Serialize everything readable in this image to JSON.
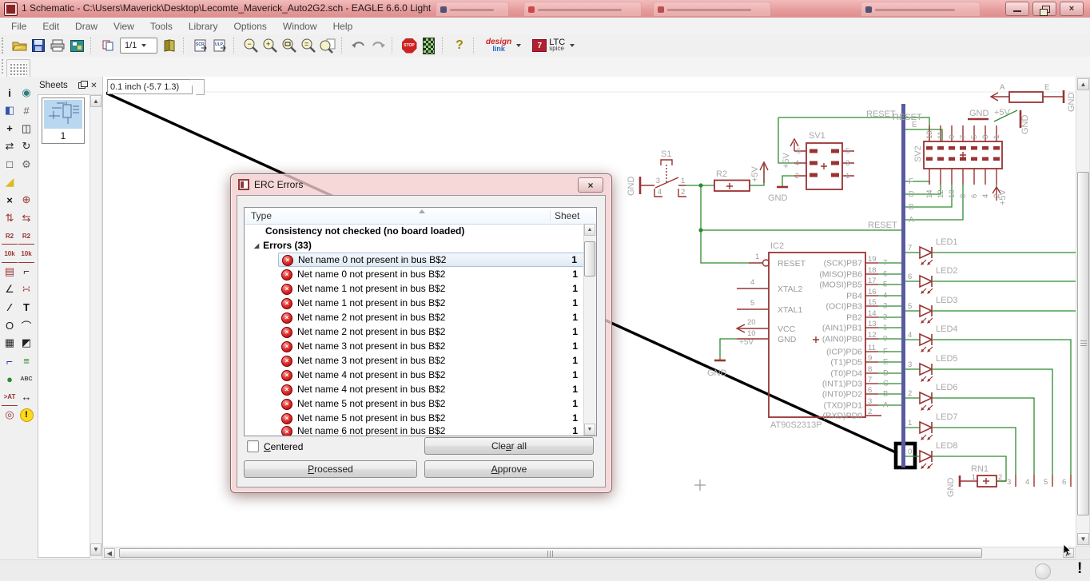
{
  "window": {
    "title": "1 Schematic - C:\\Users\\Maverick\\Desktop\\Lecomte_Maverick_Auto2G2.sch - EAGLE 6.6.0 Light",
    "close_glyph": "×"
  },
  "menu": {
    "items": [
      "File",
      "Edit",
      "Draw",
      "View",
      "Tools",
      "Library",
      "Options",
      "Window",
      "Help"
    ]
  },
  "toolbar": {
    "sheet_selector": "1/1",
    "scr": "SCR",
    "ulp": "ULP",
    "stop": "STOP",
    "help": "?",
    "design": "design",
    "link": "link",
    "ltc_logo": "7",
    "ltc": "LTC",
    "spice": "spice",
    "zoom_glyphs": [
      "−",
      "+",
      "▭",
      "=",
      "↻"
    ]
  },
  "coord_box": "0.1 inch (-5.7 1.3)",
  "sheets": {
    "title": "Sheets",
    "sheet1": "1"
  },
  "left_toolbar": [
    [
      {
        "name": "info",
        "glyph": "i",
        "cls": "g-bold"
      },
      {
        "name": "show",
        "glyph": "◉",
        "cls": "g-teal"
      }
    ],
    [
      {
        "name": "display",
        "glyph": "◧",
        "cls": "g-blue"
      },
      {
        "name": "grid",
        "glyph": "#",
        "cls": "g-gray"
      }
    ],
    [
      {
        "name": "move",
        "glyph": "+",
        "cls": "g-bold"
      },
      {
        "name": "copy",
        "glyph": "◫",
        "cls": "g-dark"
      }
    ],
    [
      {
        "name": "mirror",
        "glyph": "⇄",
        "cls": "g-dark"
      },
      {
        "name": "rotate",
        "glyph": "↻",
        "cls": "g-dark"
      }
    ],
    [
      {
        "name": "group",
        "glyph": "□",
        "cls": "g-dark"
      },
      {
        "name": "change",
        "glyph": "⚙",
        "cls": "g-gray"
      }
    ],
    [
      {
        "name": "cut",
        "glyph": "◢",
        "cls": "g-yellow"
      },
      null
    ],
    [
      {
        "name": "delete",
        "glyph": "×",
        "cls": "g-bold"
      },
      {
        "name": "add",
        "glyph": "⊕",
        "cls": "g-maroon"
      }
    ],
    [
      {
        "name": "pinswap",
        "glyph": "⇅",
        "cls": "g-maroon"
      },
      {
        "name": "gateswap",
        "glyph": "⇆",
        "cls": "g-maroon"
      }
    ],
    [
      {
        "name": "name",
        "glyph": "R2",
        "cls": "g-tiny"
      },
      {
        "name": "smash-name",
        "glyph": "R2",
        "cls": "g-tiny"
      }
    ],
    [
      {
        "name": "value",
        "glyph": "10k",
        "cls": "g-tiny"
      },
      {
        "name": "value-alt",
        "glyph": "10k",
        "cls": "g-tiny"
      }
    ],
    [
      {
        "name": "smash",
        "glyph": "▤",
        "cls": "g-maroon"
      },
      {
        "name": "miter",
        "glyph": "⌐",
        "cls": "g-dark"
      }
    ],
    [
      {
        "name": "split",
        "glyph": "∠",
        "cls": "g-dark"
      },
      {
        "name": "invoke",
        "glyph": "∺",
        "cls": "g-maroon"
      }
    ],
    [
      {
        "name": "wire",
        "glyph": "∕",
        "cls": "g-bold"
      },
      {
        "name": "text",
        "glyph": "T",
        "cls": "g-bold"
      }
    ],
    [
      {
        "name": "circle",
        "glyph": "O",
        "cls": "g-dark"
      },
      {
        "name": "arc",
        "glyph": "⌒",
        "cls": "g-dark"
      }
    ],
    [
      {
        "name": "rect",
        "glyph": "▦",
        "cls": "g-dark"
      },
      {
        "name": "polygon",
        "glyph": "◩",
        "cls": "g-dark"
      }
    ],
    [
      {
        "name": "bus",
        "glyph": "⌐",
        "cls": "g-blue-b"
      },
      {
        "name": "net",
        "glyph": "≡",
        "cls": "g-green"
      }
    ],
    [
      {
        "name": "junction",
        "glyph": "●",
        "cls": "g-green"
      },
      {
        "name": "label",
        "glyph": "ABC",
        "cls": "g-tinyg"
      }
    ],
    [
      {
        "name": "attribute",
        "glyph": ">AT",
        "cls": "g-tiny"
      },
      {
        "name": "dimension",
        "glyph": "↔",
        "cls": "g-dark"
      }
    ],
    [
      {
        "name": "erc",
        "glyph": "◎",
        "cls": "g-maroon"
      },
      {
        "name": "errors",
        "glyph": "!",
        "cls": "g-err"
      }
    ]
  ],
  "dialog": {
    "title": "ERC Errors",
    "close_glyph": "×",
    "columns": [
      "Type",
      "Sheet"
    ],
    "group_arrow": "◢",
    "error_icon_glyph": "×",
    "consistency_row": "Consistency not checked (no board loaded)",
    "errors_group": "Errors (33)",
    "errors": [
      {
        "text": "Net name 0 not present in bus B$2",
        "sheet": "1",
        "selected": true
      },
      {
        "text": "Net name 0 not present in bus B$2",
        "sheet": "1"
      },
      {
        "text": "Net name 1 not present in bus B$2",
        "sheet": "1"
      },
      {
        "text": "Net name 1 not present in bus B$2",
        "sheet": "1"
      },
      {
        "text": "Net name 2 not present in bus B$2",
        "sheet": "1"
      },
      {
        "text": "Net name 2 not present in bus B$2",
        "sheet": "1"
      },
      {
        "text": "Net name 3 not present in bus B$2",
        "sheet": "1"
      },
      {
        "text": "Net name 3 not present in bus B$2",
        "sheet": "1"
      },
      {
        "text": "Net name 4 not present in bus B$2",
        "sheet": "1"
      },
      {
        "text": "Net name 4 not present in bus B$2",
        "sheet": "1"
      },
      {
        "text": "Net name 5 not present in bus B$2",
        "sheet": "1"
      },
      {
        "text": "Net name 5 not present in bus B$2",
        "sheet": "1"
      },
      {
        "text": "Net name 6 not present in bus B$2",
        "sheet": "1",
        "clipped": true
      }
    ],
    "centered": {
      "pre": "",
      "key": "C",
      "post": "entered"
    },
    "buttons": {
      "clear": {
        "pre": "Cle",
        "key": "a",
        "post": "r all"
      },
      "processed": {
        "pre": "",
        "key": "P",
        "post": "rocessed"
      },
      "approve": {
        "pre": "",
        "key": "A",
        "post": "pprove"
      }
    }
  },
  "schematic": {
    "colors": {
      "symbol": "#993333",
      "wire": "#2e8b2e",
      "bus": "#5a5aa2",
      "label": "#a9a9a9"
    },
    "ic2": {
      "ref": "IC2",
      "value": "AT90S2313P",
      "left_pins": [
        [
          "1",
          "RESET"
        ],
        [
          "4",
          "XTAL2"
        ],
        [
          "5",
          "XTAL1"
        ],
        [
          "20",
          "VCC"
        ],
        [
          "10",
          "GND"
        ]
      ],
      "pb_pins": [
        [
          "19",
          "(SCK)PB7",
          "7"
        ],
        [
          "18",
          "(MISO)PB6",
          "6"
        ],
        [
          "17",
          "(MOSI)PB5",
          "5"
        ],
        [
          "16",
          "PB4",
          "4"
        ],
        [
          "15",
          "(OCI)PB3",
          "3"
        ],
        [
          "14",
          "PB2",
          "2"
        ],
        [
          "13",
          "(AIN1)PB1",
          "1"
        ],
        [
          "12",
          "(AIN0)PB0",
          "0"
        ]
      ],
      "pd_pins": [
        [
          "11",
          "(ICP)PD6",
          "F"
        ],
        [
          "9",
          "(T1)PD5",
          "E"
        ],
        [
          "8",
          "(T0)PD4",
          "D"
        ],
        [
          "7",
          "(INT1)PD3",
          "C"
        ],
        [
          "6",
          "(INT0)PD2",
          "B"
        ],
        [
          "3",
          "(TXD)PD1",
          "A"
        ],
        [
          "2",
          "(RXD)PD0",
          ""
        ]
      ]
    },
    "leds": [
      "LED1",
      "LED2",
      "LED3",
      "LED4",
      "LED5",
      "LED6",
      "LED7",
      "LED8"
    ],
    "led_bits": [
      "7",
      "6",
      "5",
      "4",
      "3",
      "2",
      "1",
      "0"
    ],
    "sv1": {
      "ref": "SV1",
      "left": [
        "6",
        "4",
        "2"
      ],
      "right": [
        "5",
        "3",
        "1"
      ],
      "gnd": "GND",
      "p5v": "+5V"
    },
    "sv2": {
      "ref": "SV2",
      "top": [
        "13",
        "11",
        "9",
        "7",
        "5",
        "3",
        "1"
      ],
      "bottom": [
        "14",
        "12",
        "10",
        "8",
        "6",
        "4",
        "2"
      ],
      "left_top_label": "E",
      "left_labels": [
        "F",
        "D",
        "B",
        "A"
      ],
      "gnd": "GND",
      "p5v": "+5V"
    },
    "s1": {
      "ref": "S1",
      "p3": "3",
      "p4": "4",
      "p1": "1",
      "p2": "2",
      "gnd": "GND"
    },
    "r2": {
      "ref": "R2",
      "p5v": "+5V"
    },
    "rn1": {
      "ref": "RN1",
      "p1": "1",
      "p2": "2",
      "pins": [
        [
          "3",
          1270
        ],
        [
          "4",
          1293
        ],
        [
          "5",
          1316
        ],
        [
          "6",
          1339
        ]
      ],
      "gnd": "GND"
    },
    "top": {
      "a": "A",
      "e": "E",
      "gnd": "GND",
      "p5v": "+5V"
    },
    "reset1": "RESET",
    "reset2": "RESET",
    "reset3": "RESET",
    "ic_gnd": "GND",
    "ic_p5v": "+5V"
  },
  "status": {
    "alert": "!"
  }
}
